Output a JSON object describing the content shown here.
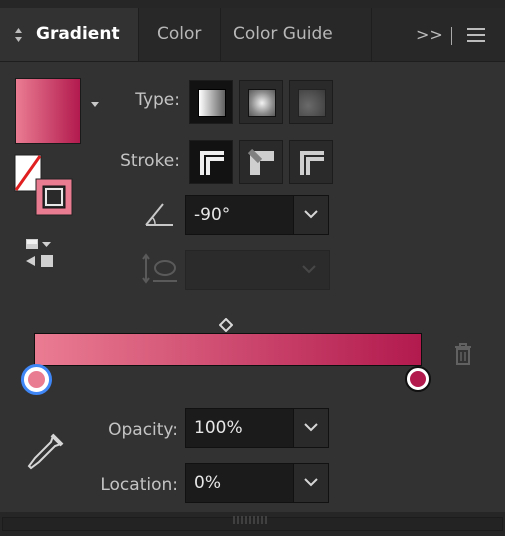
{
  "tabs": [
    {
      "label": "Gradient",
      "active": true
    },
    {
      "label": "Color",
      "active": false
    },
    {
      "label": "Color Guide",
      "active": false
    }
  ],
  "tab_overflow": ">>",
  "labels": {
    "type": "Type:",
    "stroke": "Stroke:",
    "opacity": "Opacity:",
    "location": "Location:"
  },
  "angle": {
    "value": "-90°"
  },
  "aspect_ratio": {
    "value": ""
  },
  "opacity": {
    "value": "100%"
  },
  "location": {
    "value": "0%"
  },
  "gradient": {
    "start_color": "#ea7c92",
    "end_color": "#b21a4e",
    "stops": [
      {
        "location_percent": 0,
        "color": "#ea7c92",
        "selected": true
      },
      {
        "location_percent": 100,
        "color": "#b21a4e",
        "selected": false
      }
    ],
    "midpoint_percent": 50
  },
  "colors": {
    "panel_bg": "#323232",
    "tab_bar_bg": "#282828",
    "field_bg": "#1b1b1b",
    "selected_stop_ring": "#3f86f7"
  },
  "icons": {
    "tab_menu": "hamburger-menu-icon",
    "angle": "angle-icon",
    "aspect": "aspect-ratio-icon",
    "delete": "trash-icon",
    "eyedropper": "eyedropper-icon",
    "reverse": "reverse-gradient-icon",
    "midpoint": "diamond-icon"
  }
}
